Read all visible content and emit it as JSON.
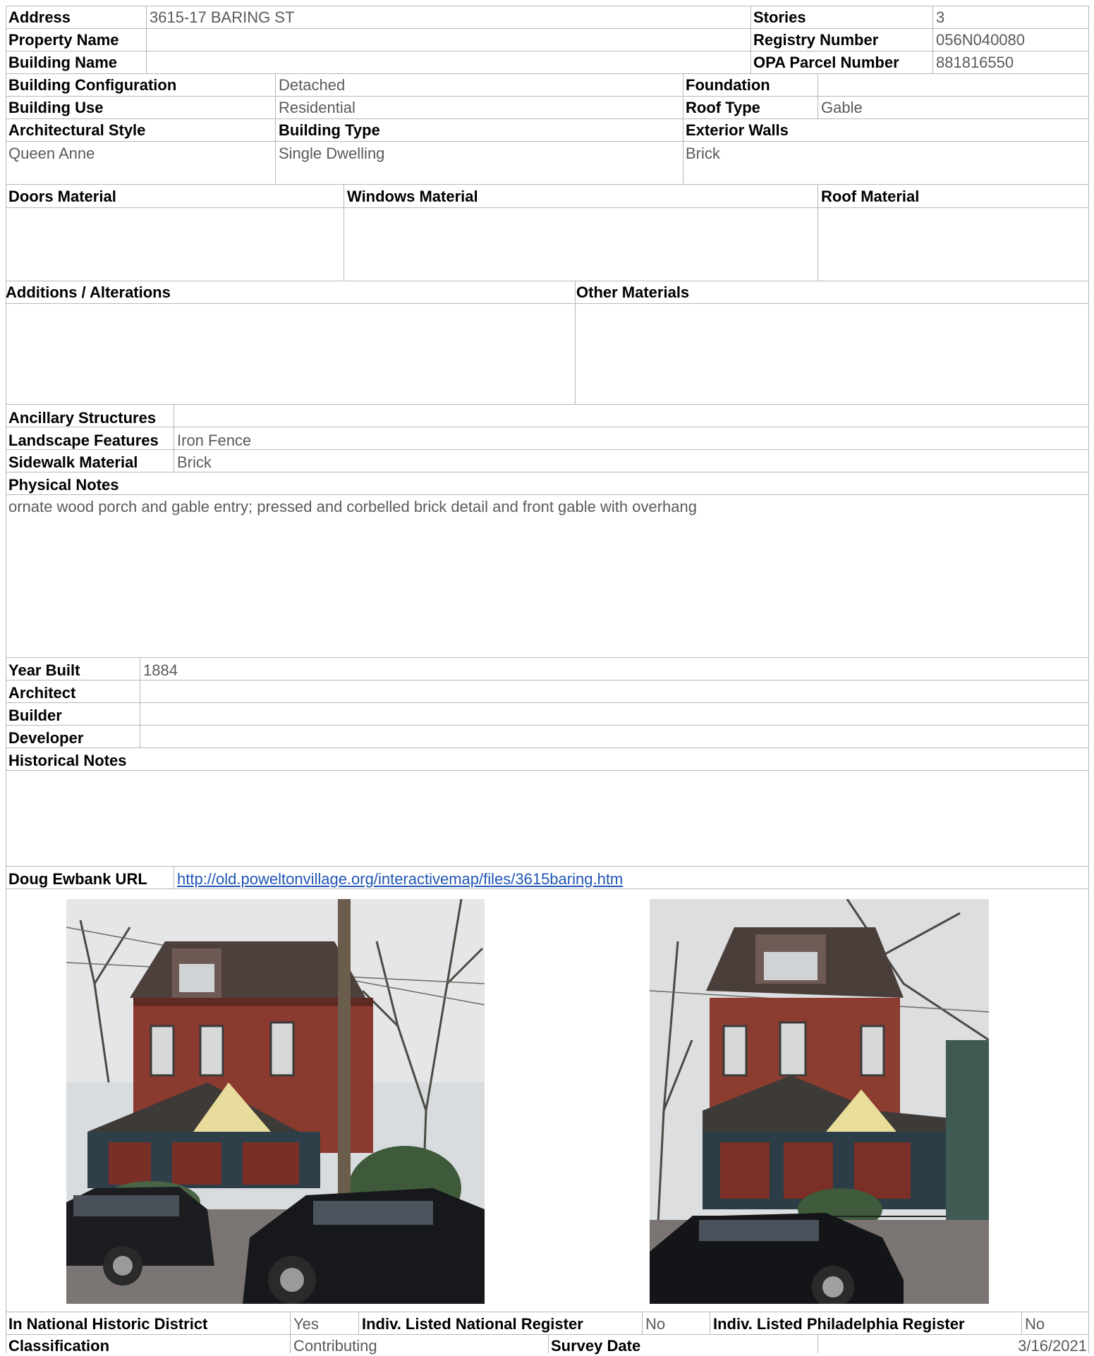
{
  "header": {
    "address": {
      "label": "Address",
      "value": "3615-17 BARING ST"
    },
    "property_name": {
      "label": "Property Name",
      "value": ""
    },
    "building_name": {
      "label": "Building Name",
      "value": ""
    },
    "stories": {
      "label": "Stories",
      "value": "3"
    },
    "registry_number": {
      "label": "Registry Number",
      "value": "056N040080"
    },
    "opa_parcel_number": {
      "label": "OPA Parcel Number",
      "value": "881816550"
    }
  },
  "building": {
    "configuration": {
      "label": "Building Configuration",
      "value": "Detached"
    },
    "use": {
      "label": "Building Use",
      "value": "Residential"
    },
    "foundation": {
      "label": "Foundation",
      "value": ""
    },
    "roof_type": {
      "label": "Roof Type",
      "value": "Gable"
    },
    "architectural_style": {
      "label": "Architectural Style",
      "value": "Queen Anne"
    },
    "building_type": {
      "label": "Building Type",
      "value": "Single Dwelling"
    },
    "exterior_walls": {
      "label": "Exterior Walls",
      "value": "Brick"
    }
  },
  "materials": {
    "doors": {
      "label": "Doors Material",
      "value": ""
    },
    "windows": {
      "label": "Windows Material",
      "value": ""
    },
    "roof": {
      "label": "Roof Material",
      "value": ""
    },
    "additions": {
      "label": "Additions / Alterations",
      "value": ""
    },
    "other": {
      "label": "Other Materials",
      "value": ""
    }
  },
  "site": {
    "ancillary": {
      "label": "Ancillary Structures",
      "value": ""
    },
    "landscape": {
      "label": "Landscape Features",
      "value": "Iron Fence"
    },
    "sidewalk": {
      "label": "Sidewalk Material",
      "value": "Brick"
    }
  },
  "physical_notes": {
    "label": "Physical Notes",
    "value": "ornate wood porch and gable entry; pressed and corbelled brick detail and front gable with overhang"
  },
  "history": {
    "year_built": {
      "label": "Year Built",
      "value": "1884"
    },
    "architect": {
      "label": "Architect",
      "value": ""
    },
    "builder": {
      "label": "Builder",
      "value": ""
    },
    "developer": {
      "label": "Developer",
      "value": ""
    },
    "historical_notes": {
      "label": "Historical Notes",
      "value": ""
    }
  },
  "ewbank": {
    "label": "Doug Ewbank URL",
    "url": "http://old.poweltonvillage.org/interactivemap/files/3615baring.htm"
  },
  "footer": {
    "national_district": {
      "label": "In National Historic District",
      "value": "Yes"
    },
    "indiv_national": {
      "label": "Indiv. Listed National Register",
      "value": "No"
    },
    "indiv_philadelphia": {
      "label": "Indiv. Listed Philadelphia Register",
      "value": "No"
    },
    "classification": {
      "label": "Classification",
      "value": "Contributing"
    },
    "survey_date": {
      "label": "Survey Date",
      "value": "3/16/2021"
    }
  },
  "colors": {
    "label_text": "#000000",
    "value_text": "#5a5a5a",
    "link": "#1f55b5",
    "grid_line": "#b7b7b7"
  }
}
